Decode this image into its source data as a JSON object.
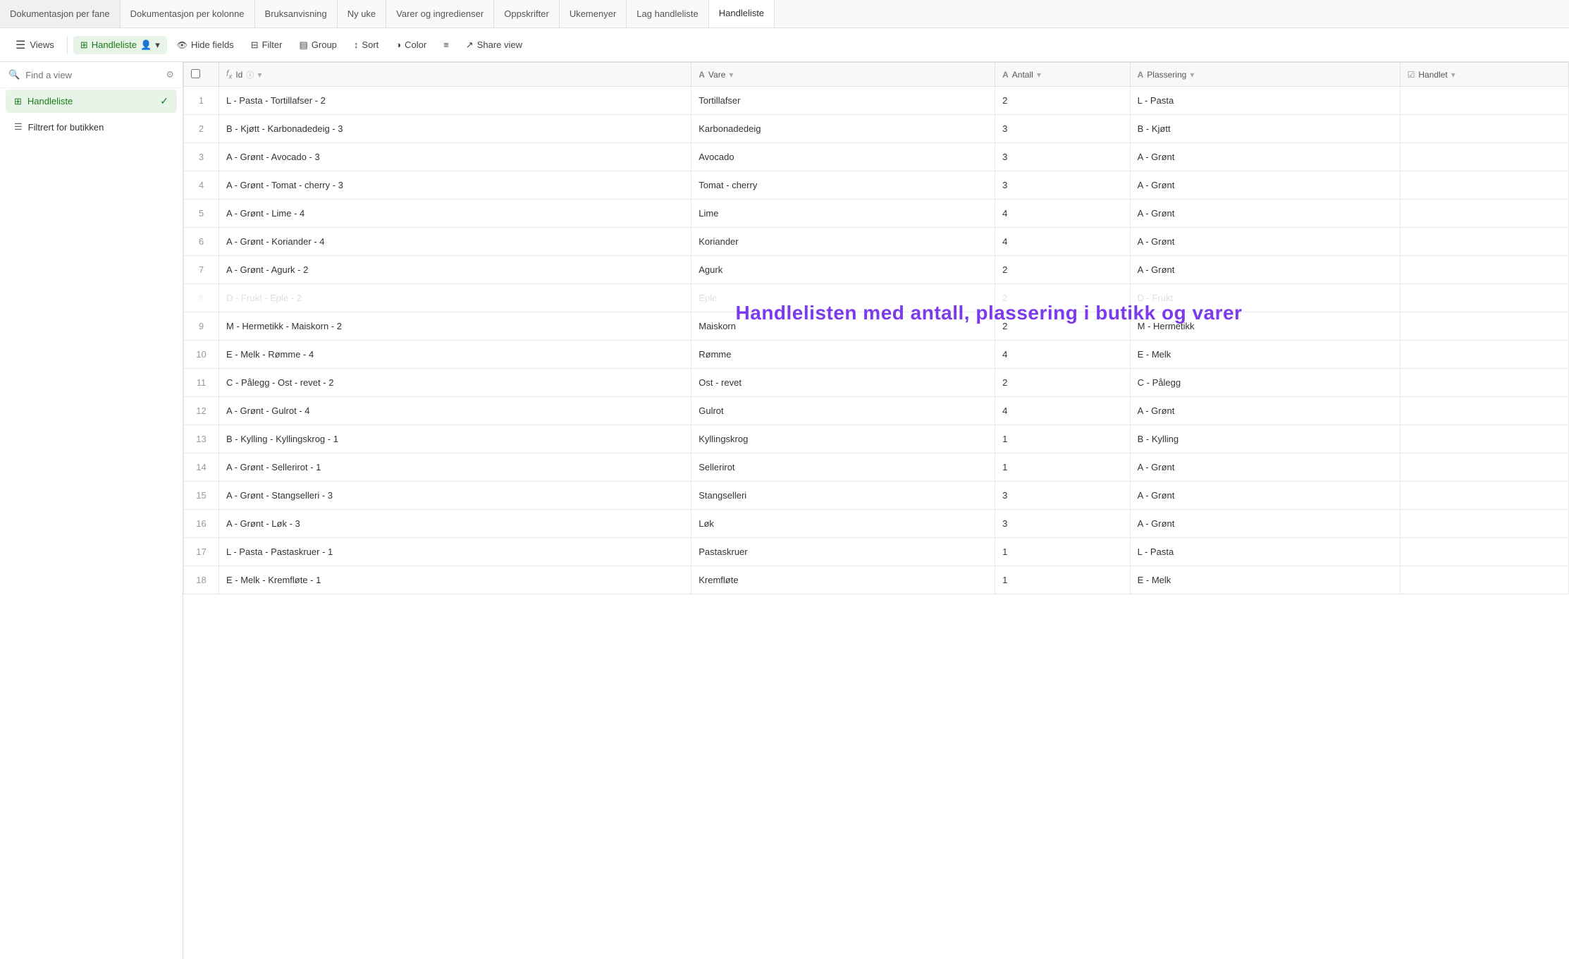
{
  "topNav": {
    "tabs": [
      {
        "id": "dok-fane",
        "label": "Dokumentasjon per fane",
        "active": false
      },
      {
        "id": "dok-kolonne",
        "label": "Dokumentasjon per kolonne",
        "active": false
      },
      {
        "id": "bruksanvisning",
        "label": "Bruksanvisning",
        "active": false
      },
      {
        "id": "ny-uke",
        "label": "Ny uke",
        "active": false
      },
      {
        "id": "varer",
        "label": "Varer og ingredienser",
        "active": false
      },
      {
        "id": "oppskrifter",
        "label": "Oppskrifter",
        "active": false
      },
      {
        "id": "ukemenyer",
        "label": "Ukemenyer",
        "active": false
      },
      {
        "id": "lag-handleliste",
        "label": "Lag handleliste",
        "active": false
      },
      {
        "id": "handleliste",
        "label": "Handleliste",
        "active": true
      }
    ]
  },
  "toolbar": {
    "views_label": "Views",
    "view_name": "Handleliste",
    "hide_fields": "Hide fields",
    "filter": "Filter",
    "group": "Group",
    "sort": "Sort",
    "color": "Color",
    "share_view": "Share view"
  },
  "sidebar": {
    "search_placeholder": "Find a view",
    "items": [
      {
        "id": "handleliste",
        "label": "Handleliste",
        "active": true
      },
      {
        "id": "filtrert",
        "label": "Filtrert for butikken",
        "active": false
      }
    ]
  },
  "table": {
    "columns": [
      {
        "id": "checkbox",
        "label": "",
        "type": "checkbox"
      },
      {
        "id": "id",
        "label": "Id",
        "type": "formula"
      },
      {
        "id": "vare",
        "label": "Vare",
        "type": "text"
      },
      {
        "id": "antall",
        "label": "Antall",
        "type": "text"
      },
      {
        "id": "plassering",
        "label": "Plassering",
        "type": "text"
      },
      {
        "id": "handlet",
        "label": "Handlet",
        "type": "checkbox"
      }
    ],
    "rows": [
      {
        "num": 1,
        "id": "L - Pasta - Tortillafser - 2",
        "vare": "Tortillafser",
        "antall": "2",
        "plassering": "L - Pasta",
        "handlet": false
      },
      {
        "num": 2,
        "id": "B - Kjøtt - Karbonadedeig - 3",
        "vare": "Karbonadedeig",
        "antall": "3",
        "plassering": "B - Kjøtt",
        "handlet": false
      },
      {
        "num": 3,
        "id": "A - Grønt - Avocado - 3",
        "vare": "Avocado",
        "antall": "3",
        "plassering": "A - Grønt",
        "handlet": false
      },
      {
        "num": 4,
        "id": "A - Grønt - Tomat - cherry - 3",
        "vare": "Tomat - cherry",
        "antall": "3",
        "plassering": "A - Grønt",
        "handlet": false
      },
      {
        "num": 5,
        "id": "A - Grønt - Lime - 4",
        "vare": "Lime",
        "antall": "4",
        "plassering": "A - Grønt",
        "handlet": false
      },
      {
        "num": 6,
        "id": "A - Grønt - Koriander - 4",
        "vare": "Koriander",
        "antall": "4",
        "plassering": "A - Grønt",
        "handlet": false
      },
      {
        "num": 7,
        "id": "A - Grønt - Agurk - 2",
        "vare": "Agurk",
        "antall": "2",
        "plassering": "A - Grønt",
        "handlet": false
      },
      {
        "num": 8,
        "id": "D - Frukt - Eple - 2",
        "vare": "Eple",
        "antall": "2",
        "plassering": "D - Frukt",
        "handlet": false
      },
      {
        "num": 9,
        "id": "M - Hermetikk - Maiskorn - 2",
        "vare": "Maiskorn",
        "antall": "2",
        "plassering": "M - Hermetikk",
        "handlet": false
      },
      {
        "num": 10,
        "id": "E - Melk - Rømme - 4",
        "vare": "Rømme",
        "antall": "4",
        "plassering": "E - Melk",
        "handlet": false
      },
      {
        "num": 11,
        "id": "C - Pålegg - Ost - revet - 2",
        "vare": "Ost - revet",
        "antall": "2",
        "plassering": "C - Pålegg",
        "handlet": false
      },
      {
        "num": 12,
        "id": "A - Grønt - Gulrot - 4",
        "vare": "Gulrot",
        "antall": "4",
        "plassering": "A - Grønt",
        "handlet": false
      },
      {
        "num": 13,
        "id": "B - Kylling - Kyllingskrog - 1",
        "vare": "Kyllingskrog",
        "antall": "1",
        "plassering": "B - Kylling",
        "handlet": false
      },
      {
        "num": 14,
        "id": "A - Grønt - Sellerirot - 1",
        "vare": "Sellerirot",
        "antall": "1",
        "plassering": "A - Grønt",
        "handlet": false
      },
      {
        "num": 15,
        "id": "A - Grønt - Stangselleri - 3",
        "vare": "Stangselleri",
        "antall": "3",
        "plassering": "A - Grønt",
        "handlet": false
      },
      {
        "num": 16,
        "id": "A - Grønt - Løk - 3",
        "vare": "Løk",
        "antall": "3",
        "plassering": "A - Grønt",
        "handlet": false
      },
      {
        "num": 17,
        "id": "L - Pasta - Pastaskruer - 1",
        "vare": "Pastaskruer",
        "antall": "1",
        "plassering": "L - Pasta",
        "handlet": false
      },
      {
        "num": 18,
        "id": "E - Melk - Kremfløte - 1",
        "vare": "Kremfløte",
        "antall": "1",
        "plassering": "E - Melk",
        "handlet": false
      }
    ],
    "overlay": "Handlelisten med antall, plassering i butikk og varer"
  }
}
